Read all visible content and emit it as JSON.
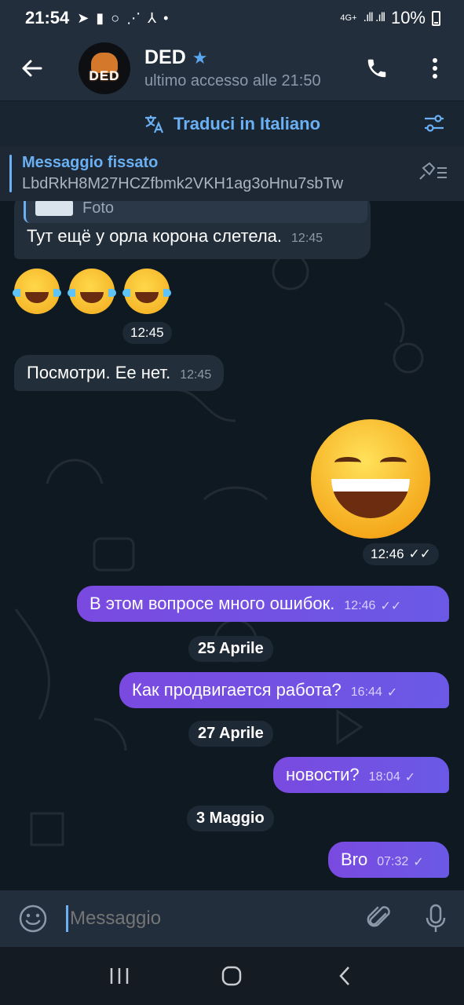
{
  "status_bar": {
    "time": "21:54",
    "network": "4G+",
    "battery": "10%"
  },
  "header": {
    "avatar_text": "DED",
    "title": "DED",
    "status": "ultimo accesso alle 21:50"
  },
  "translate_bar": {
    "label": "Traduci in Italiano"
  },
  "pinned": {
    "title": "Messaggio fissato",
    "text": "LbdRkH8M27HCZfbmk2VKH1ag3oHnu7sbTw"
  },
  "messages": [
    {
      "quote_label": "Foto",
      "text": "Тут ещё у орла корона слетела.",
      "time": "12:45",
      "direction": "in"
    },
    {
      "time_label": "12:45",
      "direction": "in",
      "kind": "emoji"
    },
    {
      "text": "Посмотри. Ее нет.",
      "time": "12:45",
      "direction": "in"
    },
    {
      "time_label": "12:46",
      "direction": "out",
      "kind": "sticker"
    },
    {
      "text": "В этом вопросе много ошибок.",
      "time": "12:46",
      "direction": "out"
    },
    {
      "text": "Как продвигается работа?",
      "time": "16:44",
      "direction": "out"
    },
    {
      "text": "новости?",
      "time": "18:04",
      "direction": "out"
    },
    {
      "text": "Bro",
      "time": "07:32",
      "direction": "out"
    }
  ],
  "dates": [
    "25 Aprile",
    "27 Aprile",
    "3 Maggio"
  ],
  "input": {
    "placeholder": "Messaggio"
  },
  "colors": {
    "accent": "#6ab0f3",
    "outgoing_bubble": "#7a4ae0",
    "incoming_bubble": "#222e3a"
  }
}
